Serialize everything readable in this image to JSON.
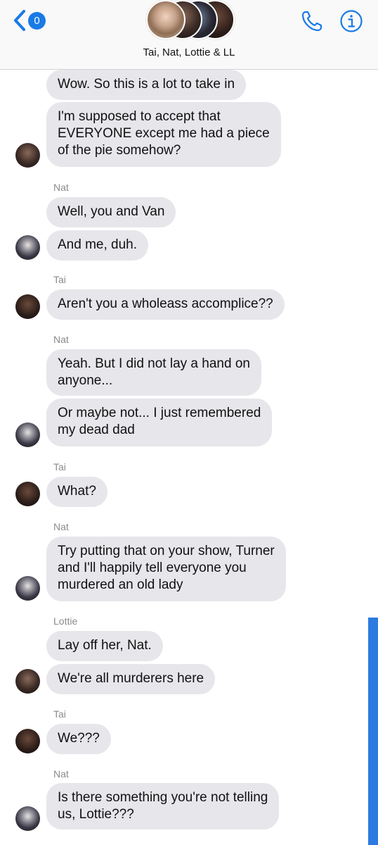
{
  "header": {
    "back_count": "0",
    "title": "Tai, Nat, Lottie & LL"
  },
  "messages": [
    {
      "text": "Wow. So this is a lot to take in"
    },
    {
      "text": "I'm supposed to accept that\nEVERYONE except me had  a piece\nof the pie somehow?"
    },
    {
      "sender": "Nat"
    },
    {
      "text": "Well, you and Van"
    },
    {
      "text": "And me, duh."
    },
    {
      "sender": "Tai"
    },
    {
      "text": "Aren't you a wholeass accomplice??"
    },
    {
      "sender": "Nat"
    },
    {
      "text": "Yeah. But I did not lay a hand on\nanyone..."
    },
    {
      "text": "Or maybe not... I just remembered\nmy dead dad"
    },
    {
      "sender": "Tai"
    },
    {
      "text": "What?"
    },
    {
      "sender": "Nat"
    },
    {
      "text": "Try putting that on your show, Turner\nand I'll happily tell everyone you\nmurdered an old lady"
    },
    {
      "sender": "Lottie"
    },
    {
      "text": "Lay off her, Nat."
    },
    {
      "text": "We're all murderers here"
    },
    {
      "sender": "Tai"
    },
    {
      "text": "We???"
    },
    {
      "sender": "Nat"
    },
    {
      "text": "Is there something you're not telling\nus, Lottie???"
    }
  ],
  "colors": {
    "accent": "#1a7ae6",
    "bubble": "#e6e6eb",
    "sender_label": "#8a8a8e",
    "scrollbar": "#2c7be0"
  },
  "icons": {
    "back": "chevron-left-icon",
    "call": "phone-icon",
    "info": "info-icon"
  }
}
